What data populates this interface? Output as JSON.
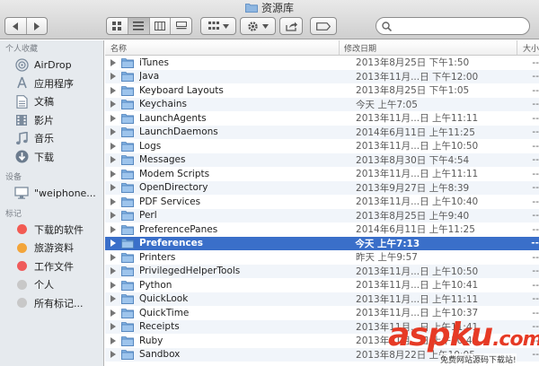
{
  "window": {
    "title": "资源库"
  },
  "toolbar": {
    "search": {
      "value": "",
      "placeholder": ""
    }
  },
  "sidebar": {
    "sections": [
      {
        "label": "个人收藏",
        "items": [
          {
            "label": "AirDrop",
            "icon": "airdrop-icon"
          },
          {
            "label": "应用程序",
            "icon": "applications-icon"
          },
          {
            "label": "文稿",
            "icon": "documents-icon"
          },
          {
            "label": "影片",
            "icon": "movies-icon"
          },
          {
            "label": "音乐",
            "icon": "music-icon"
          },
          {
            "label": "下载",
            "icon": "downloads-icon"
          }
        ]
      },
      {
        "label": "设备",
        "items": [
          {
            "label": "\"weiphone...",
            "icon": "computer-icon"
          }
        ]
      },
      {
        "label": "标记",
        "items": [
          {
            "label": "下载的软件",
            "color": "#f25b53"
          },
          {
            "label": "旅游资料",
            "color": "#f3a53a"
          },
          {
            "label": "工作文件",
            "color": "#ef5b5b"
          },
          {
            "label": "个人",
            "color": "#c8c8c8"
          },
          {
            "label": "所有标记...",
            "color": "#c8c8c8"
          }
        ]
      }
    ]
  },
  "list": {
    "headers": {
      "name": "名称",
      "date": "修改日期",
      "size": "大小"
    },
    "rows": [
      {
        "name": "iTunes",
        "date": "2013年8月25日 下午1:50"
      },
      {
        "name": "Java",
        "date": "2013年11月...日 下午12:00"
      },
      {
        "name": "Keyboard Layouts",
        "date": "2013年8月25日 下午1:05"
      },
      {
        "name": "Keychains",
        "date": "今天 上午7:05"
      },
      {
        "name": "LaunchAgents",
        "date": "2013年11月...日 上午11:11"
      },
      {
        "name": "LaunchDaemons",
        "date": "2014年6月11日 上午11:25"
      },
      {
        "name": "Logs",
        "date": "2013年11月...日 上午10:50"
      },
      {
        "name": "Messages",
        "date": "2013年8月30日 下午4:54"
      },
      {
        "name": "Modem Scripts",
        "date": "2013年11月...日 上午11:11"
      },
      {
        "name": "OpenDirectory",
        "date": "2013年9月27日 上午8:39"
      },
      {
        "name": "PDF Services",
        "date": "2013年11月...日 上午10:40"
      },
      {
        "name": "Perl",
        "date": "2013年8月25日 上午9:40"
      },
      {
        "name": "PreferencePanes",
        "date": "2014年6月11日 上午11:25"
      },
      {
        "name": "Preferences",
        "date": "今天 上午7:13",
        "selected": true
      },
      {
        "name": "Printers",
        "date": "昨天 上午9:57"
      },
      {
        "name": "PrivilegedHelperTools",
        "date": "2013年11月...日 上午10:50"
      },
      {
        "name": "Python",
        "date": "2013年11月...日 上午10:41"
      },
      {
        "name": "QuickLook",
        "date": "2013年11月...日 上午11:11"
      },
      {
        "name": "QuickTime",
        "date": "2013年11月...日 上午10:37"
      },
      {
        "name": "Receipts",
        "date": "2013年11月...日 上午11:41"
      },
      {
        "name": "Ruby",
        "date": "2013年11月...日 上午10:41"
      },
      {
        "name": "Sandbox",
        "date": "2013年8月22日 上午10:05"
      }
    ]
  },
  "watermark": {
    "main_a": "asp",
    "main_b": "ku",
    "main_c": ".com",
    "sub": "免费网站源码下载站!"
  },
  "colors": {
    "selection": "#3a6fc9",
    "folder": "#7fb1e3"
  }
}
